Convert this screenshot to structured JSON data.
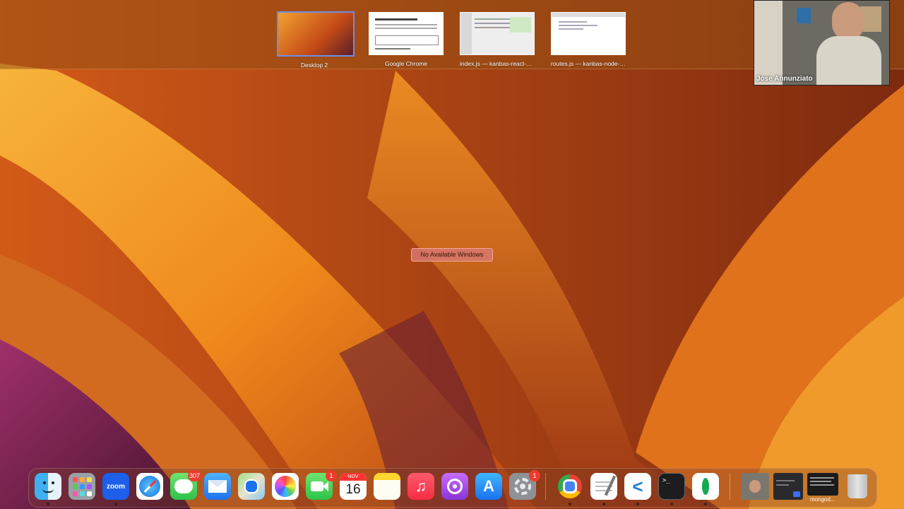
{
  "spaces": [
    {
      "label": "Desktop 2"
    },
    {
      "label": "Google Chrome"
    },
    {
      "label": "index.js — kanbas-react-w..."
    },
    {
      "label": "routes.js — kanbas-node-s..."
    }
  ],
  "center_message": "No Available Windows",
  "video_call": {
    "participant_name": "Jose Annunziato"
  },
  "dock": {
    "apps": [
      {
        "name": "finder-icon"
      },
      {
        "name": "launchpad-icon"
      },
      {
        "name": "zoom-icon",
        "text": "zoom"
      },
      {
        "name": "safari-icon"
      },
      {
        "name": "messages-icon",
        "badge": "307"
      },
      {
        "name": "mail-icon"
      },
      {
        "name": "maps-icon"
      },
      {
        "name": "photos-icon"
      },
      {
        "name": "facetime-icon",
        "badge": "1"
      },
      {
        "name": "calendar-icon",
        "month": "NOV",
        "day": "16"
      },
      {
        "name": "notes-icon"
      },
      {
        "name": "music-icon"
      },
      {
        "name": "podcasts-icon"
      },
      {
        "name": "app-store-icon"
      },
      {
        "name": "system-settings-icon",
        "badge": "1"
      },
      {
        "name": "chrome-icon"
      },
      {
        "name": "textedit-icon"
      },
      {
        "name": "vscode-icon"
      },
      {
        "name": "terminal-icon",
        "text": ">_"
      },
      {
        "name": "mongodb-compass-icon"
      }
    ],
    "minimized_label": "mongod..."
  }
}
